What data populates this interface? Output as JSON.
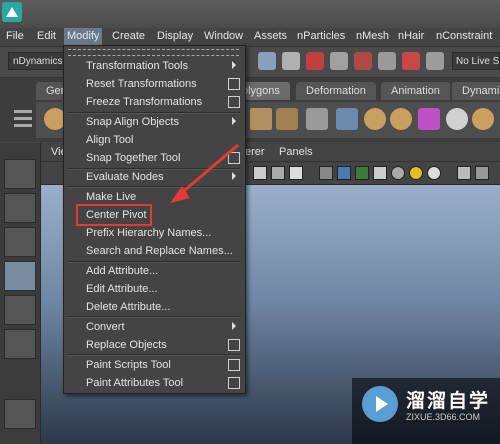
{
  "menubar": {
    "items": [
      "File",
      "Edit",
      "Modify",
      "Create",
      "Display",
      "Window",
      "Assets",
      "nParticles",
      "nMesh",
      "nHair",
      "nConstraint"
    ]
  },
  "toolbar": {
    "mode_selector": "nDynamics",
    "live_surface": "No Live Su"
  },
  "shelf": {
    "tabs": [
      "Gen",
      "olygons",
      "Deformation",
      "Animation",
      "Dynami"
    ]
  },
  "panel": {
    "menu": [
      "Vie",
      "erer",
      "Panels"
    ]
  },
  "modify_menu": {
    "items": [
      {
        "label": "Transformation Tools",
        "type": "submenu"
      },
      {
        "label": "Reset Transformations",
        "type": "option"
      },
      {
        "label": "Freeze Transformations",
        "type": "option"
      },
      {
        "label": "Snap Align Objects",
        "type": "submenu"
      },
      {
        "label": "Align Tool",
        "type": "plain"
      },
      {
        "label": "Snap Together Tool",
        "type": "option"
      },
      {
        "label": "Evaluate Nodes",
        "type": "submenu"
      },
      {
        "label": "Make Live",
        "type": "plain"
      },
      {
        "label": "Center Pivot",
        "type": "plain"
      },
      {
        "label": "Prefix Hierarchy Names...",
        "type": "plain"
      },
      {
        "label": "Search and Replace Names...",
        "type": "plain"
      },
      {
        "label": "Add Attribute...",
        "type": "plain"
      },
      {
        "label": "Edit Attribute...",
        "type": "plain"
      },
      {
        "label": "Delete Attribute...",
        "type": "plain"
      },
      {
        "label": "Convert",
        "type": "submenu"
      },
      {
        "label": "Replace Objects",
        "type": "option"
      },
      {
        "label": "Paint Scripts Tool",
        "type": "option"
      },
      {
        "label": "Paint Attributes Tool",
        "type": "option"
      }
    ]
  },
  "annotation": {
    "highlight_color": "#e53935"
  },
  "watermark": {
    "title": "溜溜自学",
    "url": "ZIXUE.3D66.COM"
  }
}
